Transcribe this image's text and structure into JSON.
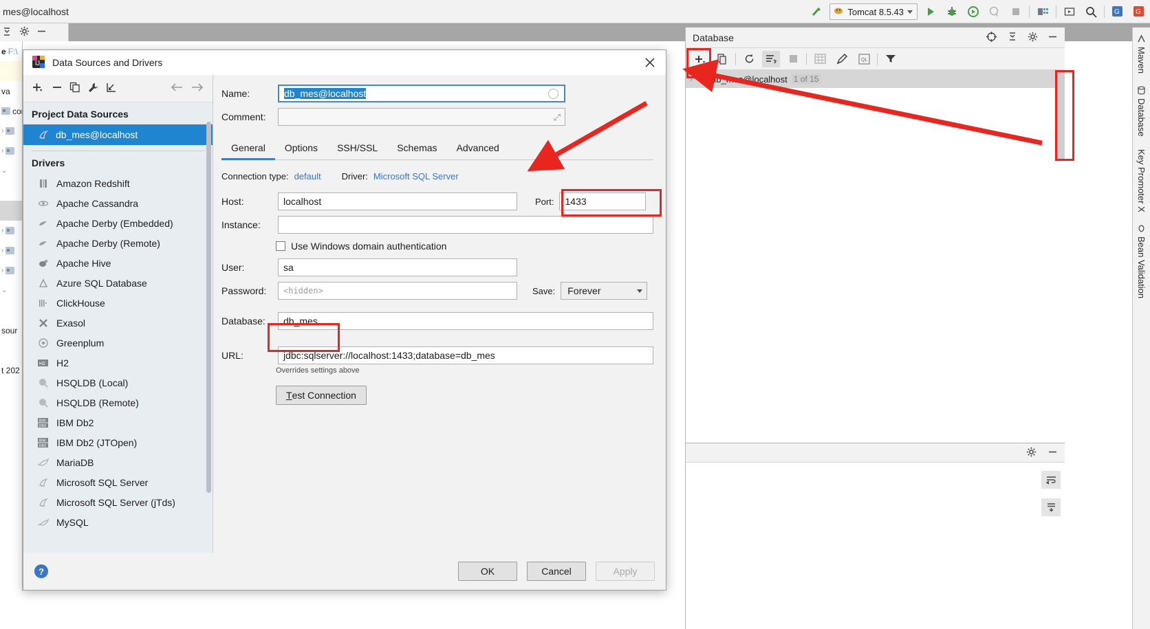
{
  "ide": {
    "title": "mes@localhost",
    "run_config": "Tomcat 8.5.43",
    "toolbar_icons": [
      "hammer-icon",
      "run-icon",
      "debug-icon",
      "run-with-coverage-icon",
      "profile-icon",
      "stop-icon",
      "project-structure-icon",
      "update-app-icon",
      "search-everywhere-icon",
      "translate-icon",
      "translate-alt-icon"
    ],
    "toolbar2_icons": [
      "collapse-all-icon",
      "settings-gear-icon",
      "hide-icon"
    ],
    "project_tree": [
      {
        "text": "F:\\",
        "prefix": "e"
      },
      {
        "text": ""
      },
      {
        "text": "va"
      },
      {
        "text": "cor"
      },
      {
        "text": ""
      },
      {
        "text": ""
      },
      {
        "text": ""
      },
      {
        "text": ""
      },
      {
        "text": ""
      },
      {
        "text": ""
      },
      {
        "text": ""
      },
      {
        "text": "sour"
      },
      {
        "text": "t 202"
      }
    ]
  },
  "database_panel": {
    "title": "Database",
    "head_icons": [
      "target-icon",
      "collapse-all-icon",
      "settings-gear-icon",
      "hide-icon"
    ],
    "toolbar_icons": [
      "add-icon",
      "duplicate-icon",
      "refresh-icon",
      "sync-scheme-icon",
      "stop-icon",
      "table-icon",
      "edit-icon",
      "query-console-icon",
      "filter-icon"
    ],
    "tree_node": "db_mes@localhost",
    "tree_node_count": "1 of 15"
  },
  "lower_panel": {
    "icons": [
      "settings-gear-icon",
      "hide-icon"
    ],
    "side_buttons": [
      "wrap-text-icon",
      "scroll-to-end-icon"
    ]
  },
  "right_strip": {
    "labels": [
      "Maven",
      "Database",
      "Key Promoter X",
      "Bean Validation"
    ]
  },
  "dialog": {
    "title": "Data Sources and Drivers",
    "title_icon": "intellij-idea-icon",
    "close_icon": "close-icon",
    "left_toolbar_icons": [
      "add-icon",
      "remove-icon",
      "copy-icon",
      "wrench-icon",
      "import-icon",
      "back-arrow-icon",
      "forward-arrow-icon"
    ],
    "sections": {
      "project_data_sources": "Project Data Sources",
      "drivers": "Drivers"
    },
    "data_sources": [
      {
        "label": "db_mes@localhost",
        "icon": "mssql-icon",
        "selected": true
      }
    ],
    "drivers": [
      {
        "label": "Amazon Redshift",
        "icon": "redshift-icon"
      },
      {
        "label": "Apache Cassandra",
        "icon": "cassandra-icon"
      },
      {
        "label": "Apache Derby (Embedded)",
        "icon": "derby-icon"
      },
      {
        "label": "Apache Derby (Remote)",
        "icon": "derby-icon"
      },
      {
        "label": "Apache Hive",
        "icon": "hive-icon"
      },
      {
        "label": "Azure SQL Database",
        "icon": "azure-icon"
      },
      {
        "label": "ClickHouse",
        "icon": "clickhouse-icon"
      },
      {
        "label": "Exasol",
        "icon": "exasol-icon"
      },
      {
        "label": "Greenplum",
        "icon": "greenplum-icon"
      },
      {
        "label": "H2",
        "icon": "h2-icon"
      },
      {
        "label": "HSQLDB (Local)",
        "icon": "hsqldb-icon"
      },
      {
        "label": "HSQLDB (Remote)",
        "icon": "hsqldb-icon"
      },
      {
        "label": "IBM Db2",
        "icon": "db2-icon"
      },
      {
        "label": "IBM Db2 (JTOpen)",
        "icon": "db2-icon"
      },
      {
        "label": "MariaDB",
        "icon": "mariadb-icon"
      },
      {
        "label": "Microsoft SQL Server",
        "icon": "mssql-icon"
      },
      {
        "label": "Microsoft SQL Server (jTds)",
        "icon": "mssql-icon"
      },
      {
        "label": "MySQL",
        "icon": "mysql-icon"
      }
    ],
    "form": {
      "name_label": "Name:",
      "name_value": "db_mes@localhost",
      "comment_label": "Comment:",
      "comment_value": "",
      "tabs": [
        {
          "label": "General",
          "active": true
        },
        {
          "label": "Options",
          "active": false
        },
        {
          "label": "SSH/SSL",
          "active": false
        },
        {
          "label": "Schemas",
          "active": false
        },
        {
          "label": "Advanced",
          "active": false
        }
      ],
      "connection_type_label": "Connection type:",
      "connection_type_value": "default",
      "driver_label": "Driver:",
      "driver_value": "Microsoft SQL Server",
      "host_label": "Host:",
      "host_value": "localhost",
      "port_label": "Port:",
      "port_value": "1433",
      "instance_label": "Instance:",
      "instance_value": "",
      "windows_auth_label": "Use Windows domain authentication",
      "windows_auth_checked": false,
      "user_label": "User:",
      "user_value": "sa",
      "password_label": "Password:",
      "password_placeholder": "<hidden>",
      "save_label": "Save:",
      "save_value": "Forever",
      "database_label": "Database:",
      "database_value": "db_mes",
      "url_label": "URL:",
      "url_value": "jdbc:sqlserver://localhost:1433;database=db_mes",
      "url_hint": "Overrides settings above",
      "test_connection_label": "Test Connection"
    },
    "footer": {
      "help_icon": "help-icon",
      "ok_label": "OK",
      "cancel_label": "Cancel",
      "apply_label": "Apply",
      "apply_disabled": true
    }
  },
  "annotations": {
    "color": "#e8251f",
    "boxes": [
      "port-field-highlight",
      "database-field-highlight",
      "add-datasource-button-highlight",
      "database-tool-window-tab-highlight"
    ],
    "arrows": [
      "arrow-to-general-tab",
      "arrow-to-database-toolwindow-tab"
    ]
  }
}
